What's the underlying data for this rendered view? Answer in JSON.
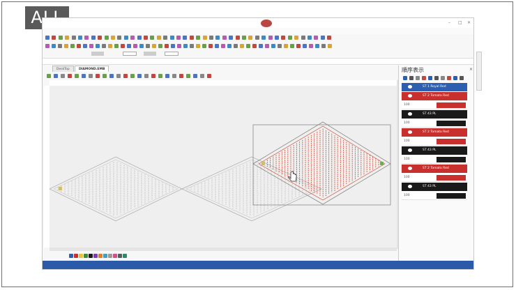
{
  "badge": "ALL",
  "panel": {
    "title": "順序表示",
    "close": "×",
    "layers": [
      {
        "kind": "header",
        "color": "#2d5fb0",
        "label": "ST 1 Royal Red"
      },
      {
        "kind": "header",
        "color": "#c8302d",
        "label": "ST 2 Tomato Red"
      },
      {
        "kind": "sub",
        "num": "100"
      },
      {
        "kind": "header",
        "color": "#1a1a1a",
        "label": "ST 43 PL"
      },
      {
        "kind": "sub",
        "num": "100"
      },
      {
        "kind": "header",
        "color": "#c8302d",
        "label": "ST 2 Tomato Red"
      },
      {
        "kind": "sub",
        "num": "100"
      },
      {
        "kind": "header",
        "color": "#1a1a1a",
        "label": "ST 43 PL"
      },
      {
        "kind": "sub",
        "num": "100"
      },
      {
        "kind": "header",
        "color": "#c8302d",
        "label": "ST 2 Tomato Red"
      },
      {
        "kind": "sub",
        "num": "100"
      },
      {
        "kind": "header",
        "color": "#1a1a1a",
        "label": "ST 43 PL"
      },
      {
        "kind": "sub",
        "num": "100"
      }
    ]
  },
  "tabs": [
    "DeskTop",
    "DIAMOND.EMB"
  ],
  "colors": {
    "stitch_selected": "#c8452e",
    "stitch_normal": "#9a9a9a",
    "status_bar": "#2b5aa8"
  }
}
